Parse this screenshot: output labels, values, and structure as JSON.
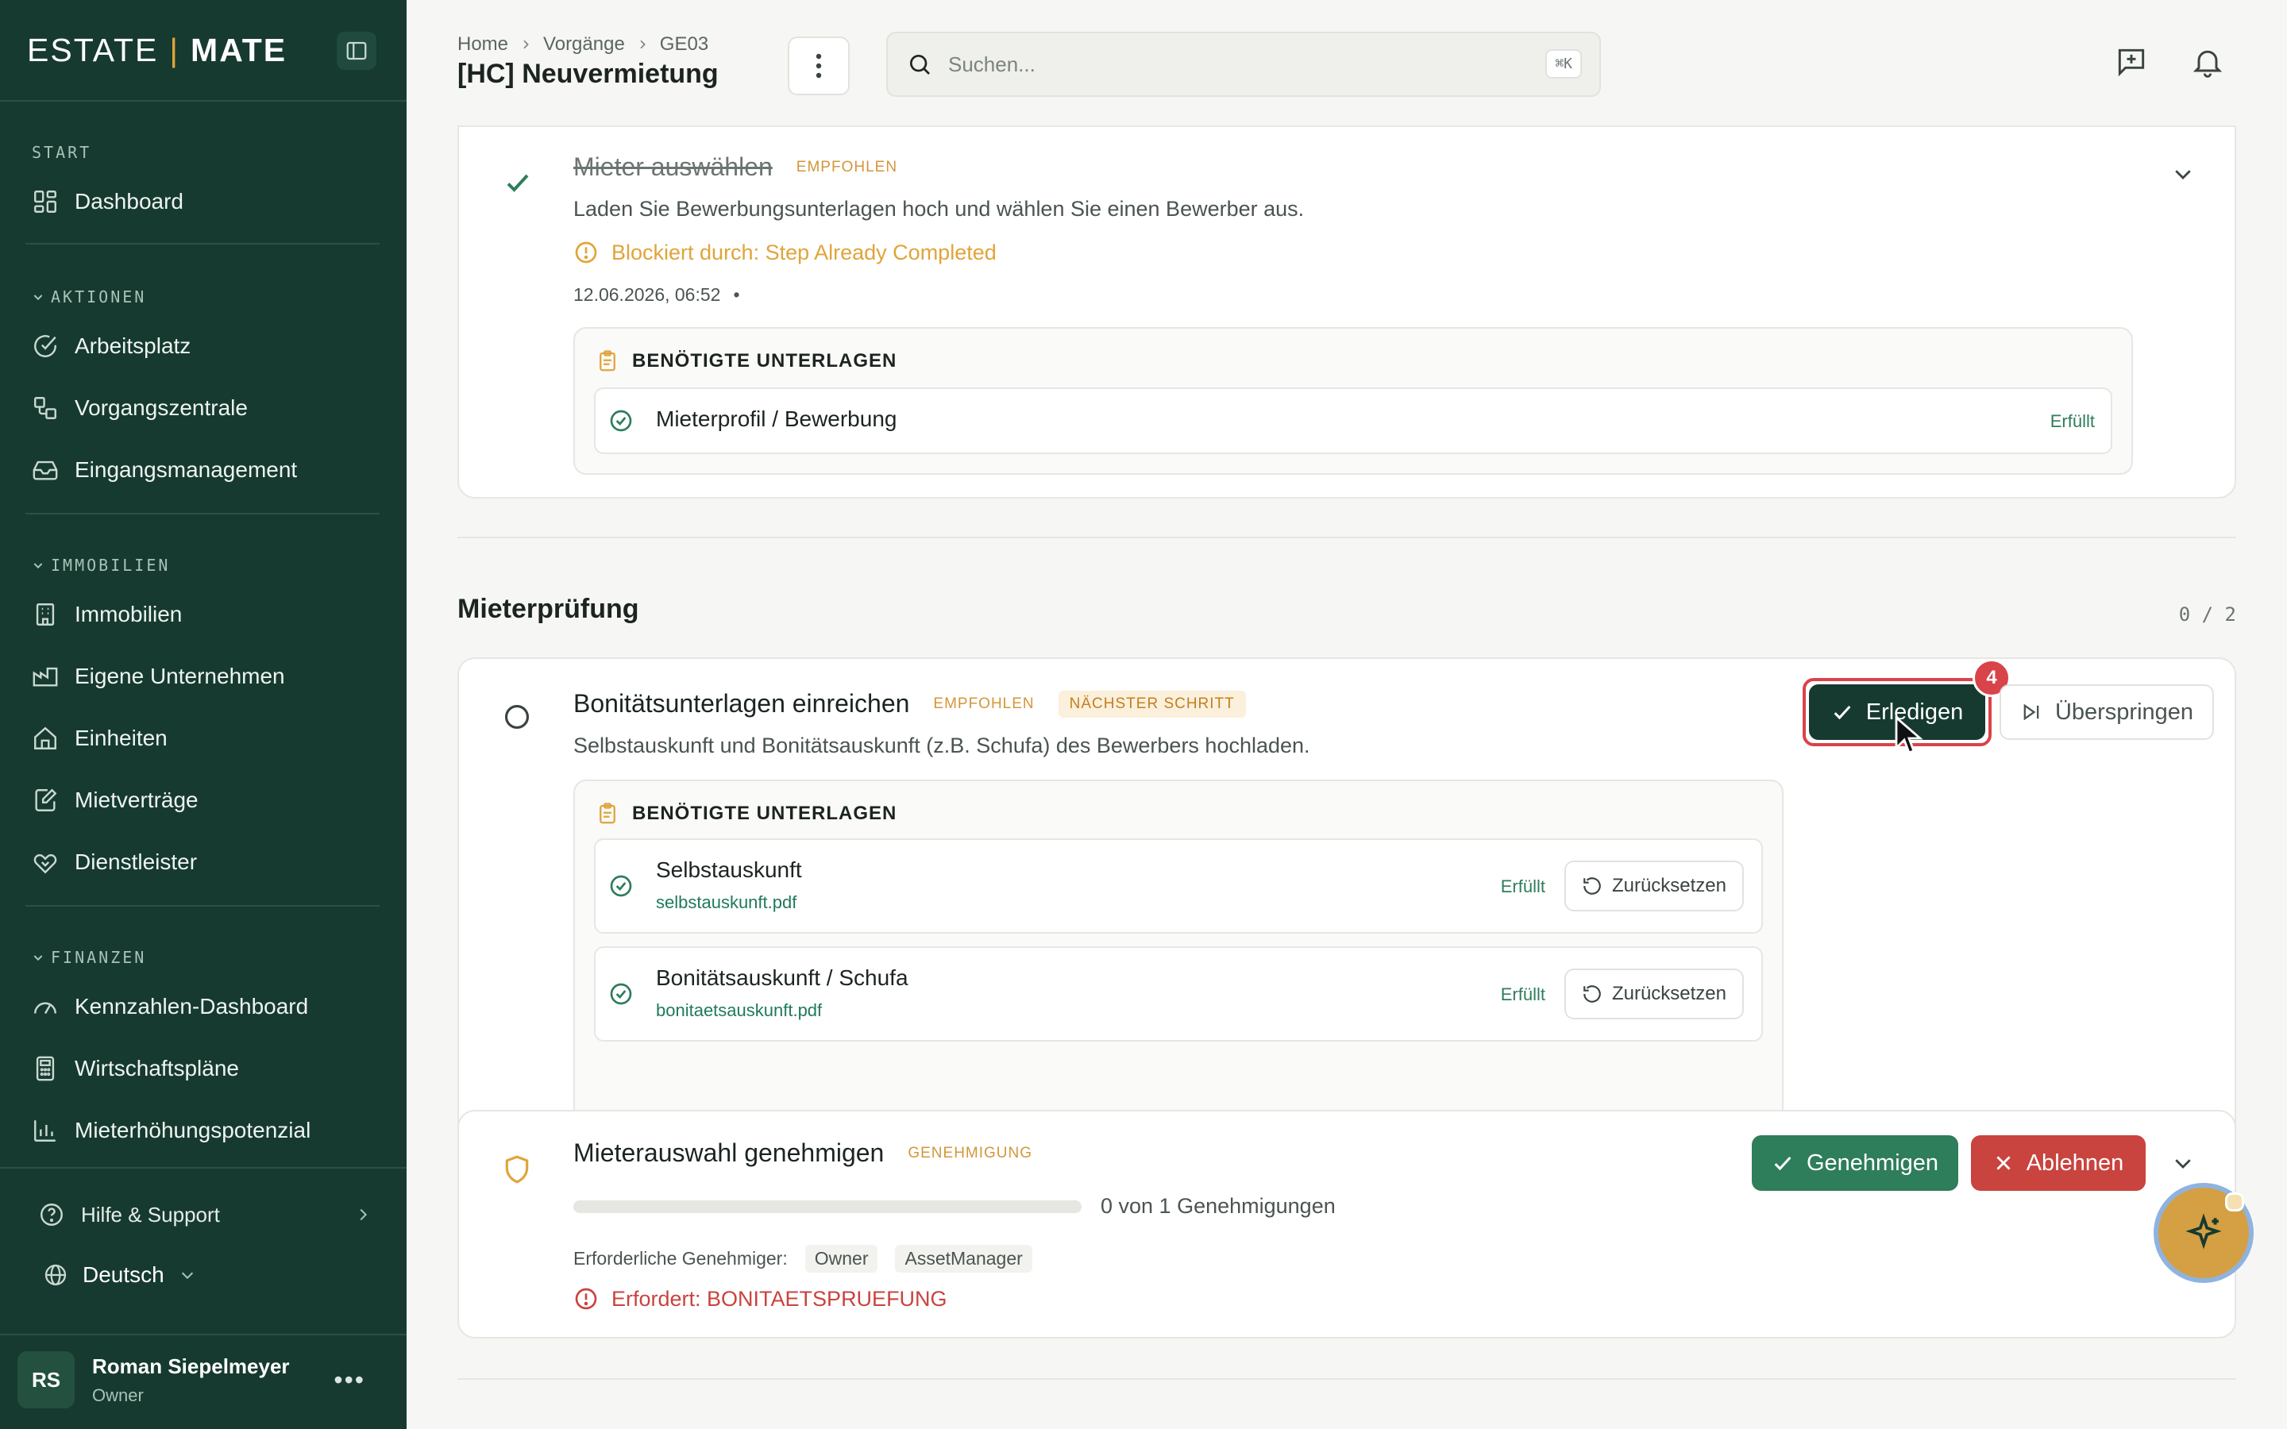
{
  "sidebar": {
    "logo_left": "ESTATE",
    "logo_sep": "|",
    "logo_right": "MATE",
    "sections": {
      "start": "START",
      "aktionen": "AKTIONEN",
      "immobilien": "IMMOBILIEN",
      "finanzen": "FINANZEN"
    },
    "items": {
      "dashboard": "Dashboard",
      "arbeitsplatz": "Arbeitsplatz",
      "vorgangszentrale": "Vorgangszentrale",
      "eingangsmanagement": "Eingangsmanagement",
      "immobilien": "Immobilien",
      "eigene_unternehmen": "Eigene Unternehmen",
      "einheiten": "Einheiten",
      "mietvertraege": "Mietverträge",
      "dienstleister": "Dienstleister",
      "kennzahlen": "Kennzahlen-Dashboard",
      "wirtschaftsplaene": "Wirtschaftspläne",
      "mieterhoehung": "Mieterhöhungspotenzial"
    },
    "help": "Hilfe & Support",
    "language": "Deutsch",
    "user": {
      "initials": "RS",
      "name": "Roman Siepelmeyer",
      "role": "Owner"
    }
  },
  "header": {
    "breadcrumb": [
      "Home",
      "Vorgänge",
      "GE03"
    ],
    "title": "[HC] Neuvermietung",
    "search_placeholder": "Suchen...",
    "search_shortcut": "⌘K"
  },
  "step_mieter": {
    "title": "Mieter auswählen",
    "badge": "EMPFOHLEN",
    "description": "Laden Sie Bewerbungsunterlagen hoch und wählen Sie einen Bewerber aus.",
    "blocked": "Blockiert durch: Step Already Completed",
    "timestamp": "12.06.2026, 06:52",
    "timestamp_dot": "•",
    "docs_title": "BENÖTIGTE UNTERLAGEN",
    "docs": [
      {
        "name": "Mieterprofil / Bewerbung",
        "status": "Erfüllt"
      }
    ]
  },
  "section": {
    "title": "Mieterprüfung",
    "counter": "0 / 2"
  },
  "step_bonitaet": {
    "title": "Bonitätsunterlagen einreichen",
    "badge": "EMPFOHLEN",
    "badge_next": "NÄCHSTER SCHRITT",
    "description": "Selbstauskunft und Bonitätsauskunft (z.B. Schufa) des Bewerbers hochladen.",
    "complete_label": "Erledigen",
    "complete_badge": "4",
    "skip_label": "Überspringen",
    "docs_title": "BENÖTIGTE UNTERLAGEN",
    "docs": [
      {
        "name": "Selbstauskunft",
        "file": "selbstauskunft.pdf",
        "status": "Erfüllt",
        "reset": "Zurücksetzen"
      },
      {
        "name": "Bonitätsauskunft / Schufa",
        "file": "bonitaetsauskunft.pdf",
        "status": "Erfüllt",
        "reset": "Zurücksetzen"
      }
    ]
  },
  "step_genehmigung": {
    "title": "Mieterauswahl genehmigen",
    "badge": "GENEHMIGUNG",
    "progress_text": "0 von 1 Genehmigungen",
    "progress_fraction": 0,
    "approvers_label": "Erforderliche Genehmiger:",
    "approvers": [
      "Owner",
      "AssetManager"
    ],
    "requires": "Erfordert: BONITAETSPRUEFUNG",
    "approve_label": "Genehmigen",
    "reject_label": "Ablehnen"
  },
  "colors": {
    "sidebar": "#163a2f",
    "accent": "#e0a43a",
    "success": "#2e7d5b",
    "danger": "#c9433f"
  }
}
